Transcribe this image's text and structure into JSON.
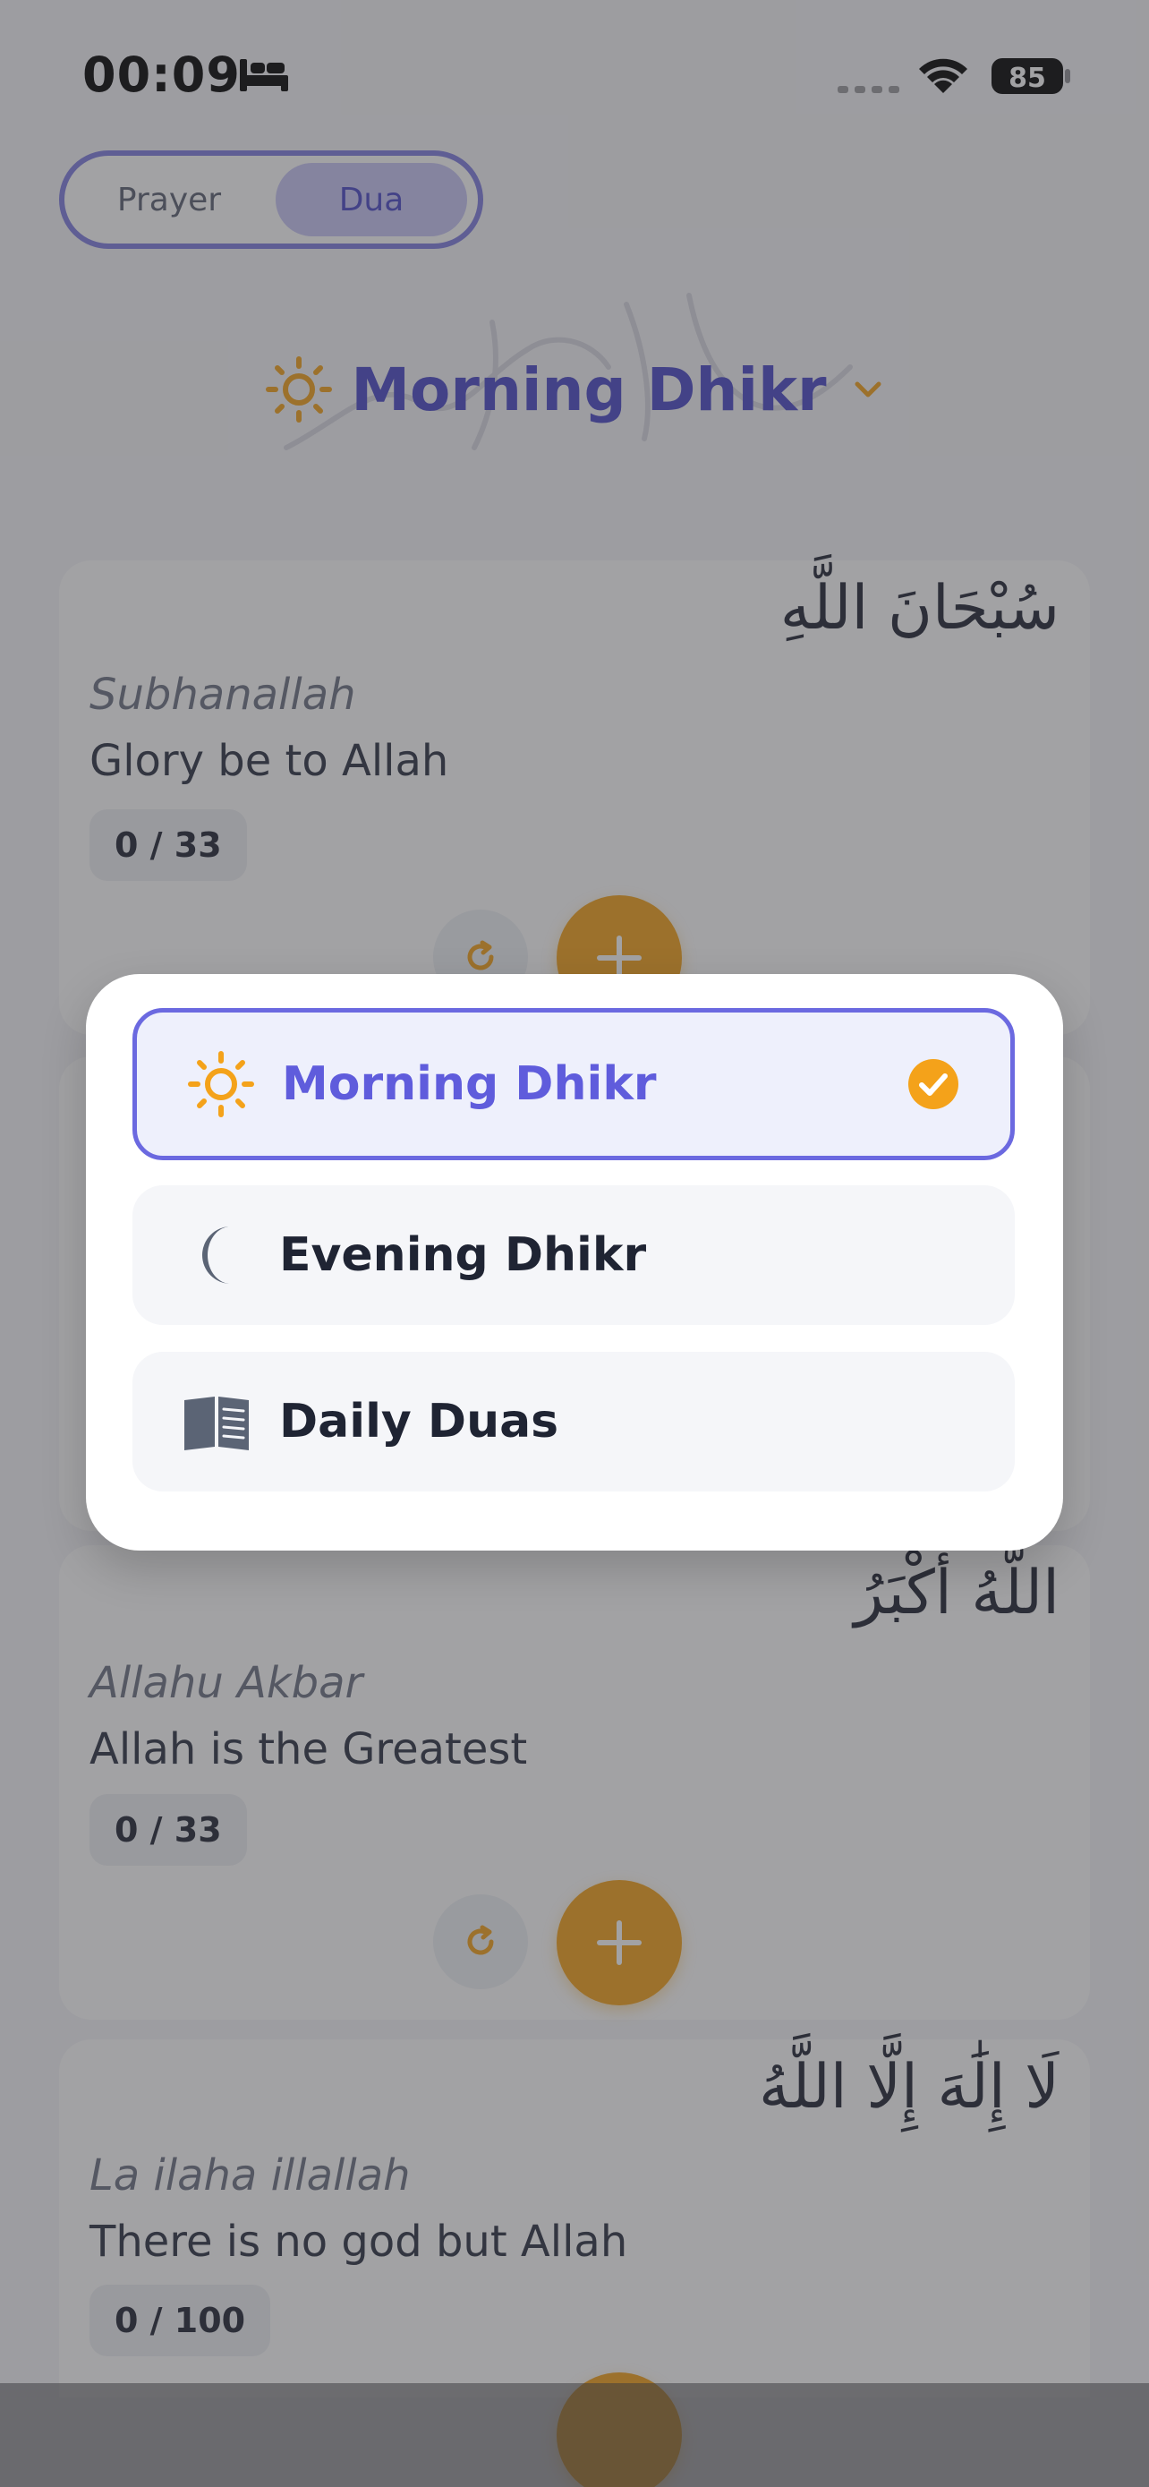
{
  "status_bar": {
    "time": "00:09",
    "battery": "85"
  },
  "segmented": {
    "prayer_label": "Prayer",
    "dua_label": "Dua",
    "active": "Dua"
  },
  "header": {
    "title": "Morning Dhikr"
  },
  "cards": [
    {
      "arabic": "سُبْحَانَ اللَّهِ",
      "translit": "Subhanallah",
      "meaning": "Glory be to Allah",
      "count": "0 / 33"
    },
    {
      "arabic": "اللَّهُ أَكْبَرُ",
      "translit": "Allahu Akbar",
      "meaning": "Allah is the Greatest",
      "count": "0 / 33"
    },
    {
      "arabic": "لَا إِلَٰهَ إِلَّا اللَّهُ",
      "translit": "La ilaha illallah",
      "meaning": "There is no god but Allah",
      "count": "0 / 100"
    }
  ],
  "dropdown": {
    "options": [
      {
        "label": "Morning Dhikr",
        "icon": "sun-icon",
        "selected": true
      },
      {
        "label": "Evening Dhikr",
        "icon": "moon-icon",
        "selected": false
      },
      {
        "label": "Daily Duas",
        "icon": "book-icon",
        "selected": false
      }
    ]
  },
  "colors": {
    "accent": "#5f5cdc",
    "orange": "#f4a21a",
    "selected_bg": "#eef0fc",
    "option_bg": "#f5f6f9"
  }
}
